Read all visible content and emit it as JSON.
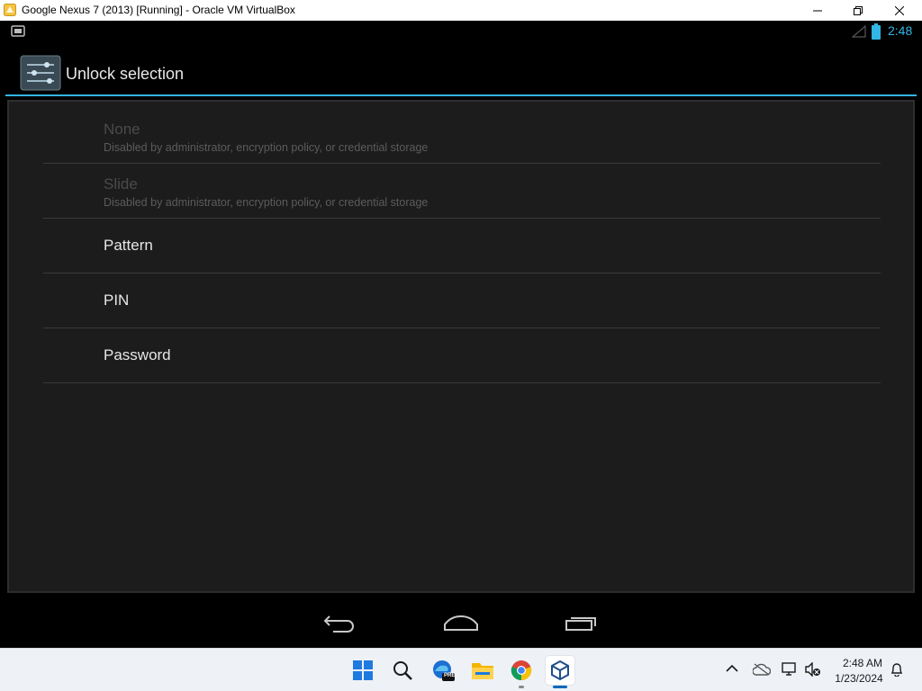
{
  "window": {
    "title": "Google Nexus 7 (2013) [Running] - Oracle VM VirtualBox",
    "buttons": [
      "minimize",
      "restore",
      "close"
    ]
  },
  "android": {
    "status_bar": {
      "time": "2:48",
      "accent_color": "#33b5e5"
    },
    "action_bar": {
      "title": "Unlock selection",
      "icon": "settings-sliders-icon"
    },
    "options": [
      {
        "label": "None",
        "summary": "Disabled by administrator, encryption policy, or credential storage",
        "enabled": false
      },
      {
        "label": "Slide",
        "summary": "Disabled by administrator, encryption policy, or credential storage",
        "enabled": false
      },
      {
        "label": "Pattern",
        "summary": "",
        "enabled": true
      },
      {
        "label": "PIN",
        "summary": "",
        "enabled": true
      },
      {
        "label": "Password",
        "summary": "",
        "enabled": true
      }
    ],
    "nav_bar": [
      "back-icon",
      "home-icon",
      "recents-icon"
    ]
  },
  "taskbar": {
    "apps": [
      "windows-start-icon",
      "search-icon",
      "edge-beta-icon",
      "file-explorer-icon",
      "chrome-icon",
      "virtualbox-icon"
    ],
    "edge_badge": "PRE",
    "clock": {
      "time": "2:48 AM",
      "date": "1/23/2024"
    }
  }
}
